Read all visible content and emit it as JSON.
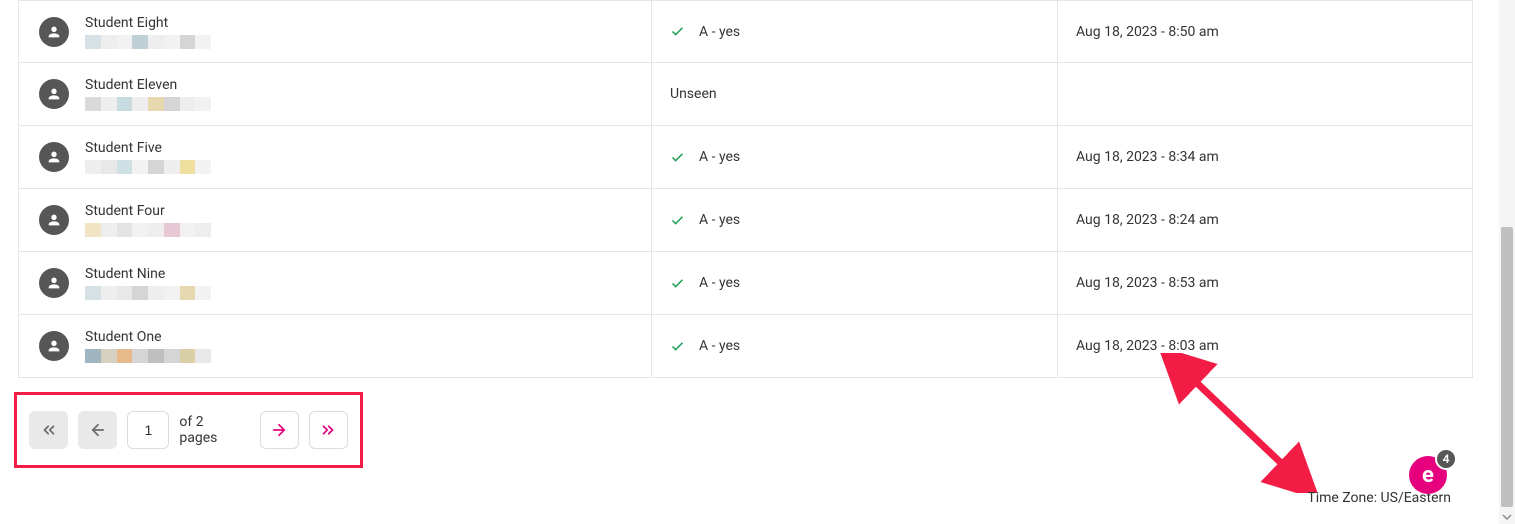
{
  "rows": [
    {
      "name": "Student Eight",
      "status_answered": true,
      "status": "A - yes",
      "date": "Aug 18, 2023 - 8:50 am",
      "blur": [
        "#d6e1e6",
        "#eeeeee",
        "#f2f2f2",
        "#bfd1d6",
        "#eeeeee",
        "#f2f2f2",
        "#d5d5d5",
        "#f2f2f2"
      ]
    },
    {
      "name": "Student Eleven",
      "status_answered": false,
      "status": "Unseen",
      "date": "",
      "blur": [
        "#dadada",
        "#eeeeee",
        "#c7dbe0",
        "#eeeeee",
        "#e8d8b0",
        "#d5d5d5",
        "#eeeeee",
        "#f2f2f2"
      ]
    },
    {
      "name": "Student Five",
      "status_answered": true,
      "status": "A - yes",
      "date": "Aug 18, 2023 - 8:34 am",
      "blur": [
        "#eeeeee",
        "#e8e8e8",
        "#cfe0e5",
        "#f2f2f2",
        "#d5d5d5",
        "#eeeeee",
        "#eedf9e",
        "#f2f2f2"
      ]
    },
    {
      "name": "Student Four",
      "status_answered": true,
      "status": "A - yes",
      "date": "Aug 18, 2023 - 8:24 am",
      "blur": [
        "#f0e4c2",
        "#eeeeee",
        "#e3e3e3",
        "#f2f2f2",
        "#eeeeee",
        "#e9c8d5",
        "#f2f2f2",
        "#eeeeee"
      ]
    },
    {
      "name": "Student Nine",
      "status_answered": true,
      "status": "A - yes",
      "date": "Aug 18, 2023 - 8:53 am",
      "blur": [
        "#d6e1e6",
        "#eeeeee",
        "#e8e8e8",
        "#d5d5d5",
        "#eeeeee",
        "#f2f2f2",
        "#e8d8b0",
        "#f2f2f2"
      ]
    },
    {
      "name": "Student One",
      "status_answered": true,
      "status": "A - yes",
      "date": "Aug 18, 2023 - 8:03 am",
      "blur": [
        "#9fb5bf",
        "#d5d0c0",
        "#e6ba8a",
        "#d5d5d5",
        "#bfbfbf",
        "#d5d5d5",
        "#d8cfa6",
        "#e8e8e8"
      ]
    }
  ],
  "pagination": {
    "current": "1",
    "total_text": "of 2 pages"
  },
  "timezone_label": "Time Zone: US/Eastern",
  "fab": {
    "letter": "e",
    "badge": "4"
  }
}
